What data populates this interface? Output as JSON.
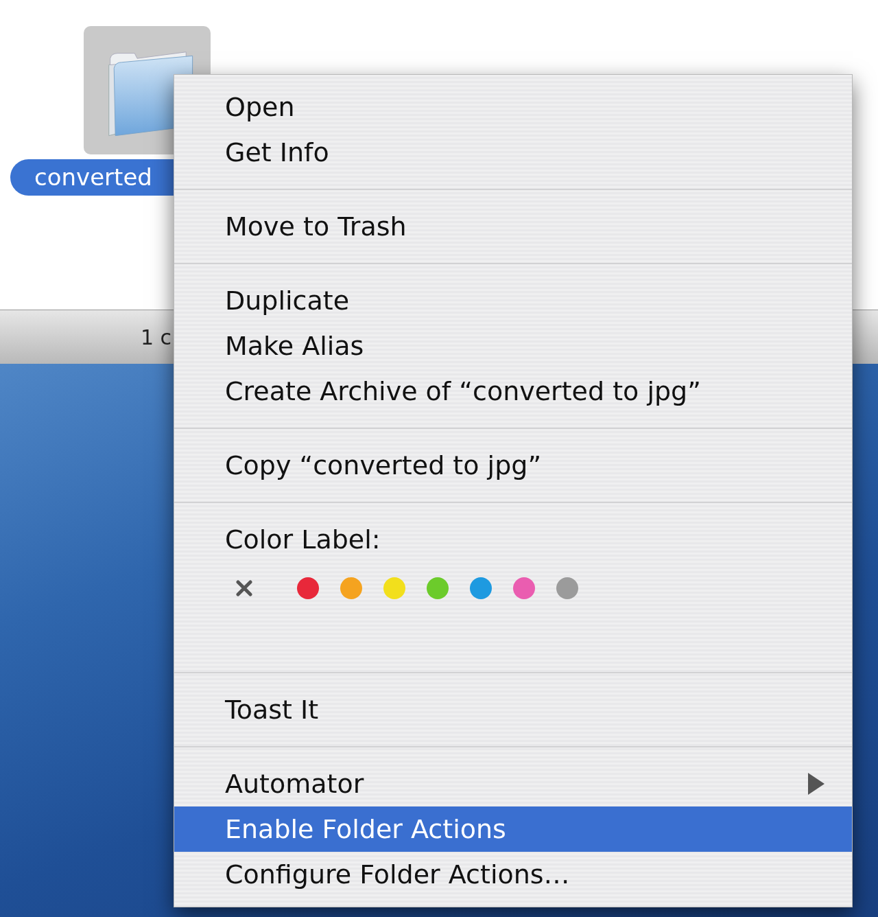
{
  "finder": {
    "folder": {
      "name": "converted",
      "selected": true
    },
    "status_bar": {
      "text": "1 c"
    }
  },
  "context_menu": {
    "items": [
      {
        "kind": "item",
        "label": "Open",
        "selected": false
      },
      {
        "kind": "item",
        "label": "Get Info",
        "selected": false
      },
      {
        "kind": "separator"
      },
      {
        "kind": "item",
        "label": "Move to Trash",
        "selected": false
      },
      {
        "kind": "separator"
      },
      {
        "kind": "item",
        "label": "Duplicate",
        "selected": false
      },
      {
        "kind": "item",
        "label": "Make Alias",
        "selected": false
      },
      {
        "kind": "item",
        "label": "Create Archive of “converted to jpg”",
        "selected": false
      },
      {
        "kind": "separator"
      },
      {
        "kind": "item",
        "label": "Copy “converted to jpg”",
        "selected": false
      },
      {
        "kind": "separator"
      },
      {
        "kind": "color_labels",
        "label": "Color Label:",
        "colors": [
          {
            "color": "#e8283a"
          },
          {
            "color": "#f5a31f"
          },
          {
            "color": "#f2df1c"
          },
          {
            "color": "#6ccb2b"
          },
          {
            "color": "#1e9ae0"
          },
          {
            "color": "#ea5db0"
          },
          {
            "color": "#9b9b9b"
          }
        ]
      },
      {
        "kind": "separator"
      },
      {
        "kind": "item",
        "label": "Toast It",
        "selected": false
      },
      {
        "kind": "separator"
      },
      {
        "kind": "item",
        "label": "Automator",
        "selected": false,
        "submenu": true
      },
      {
        "kind": "item",
        "label": "Enable Folder Actions",
        "selected": true
      },
      {
        "kind": "item",
        "label": "Configure Folder Actions…",
        "selected": false
      }
    ]
  }
}
